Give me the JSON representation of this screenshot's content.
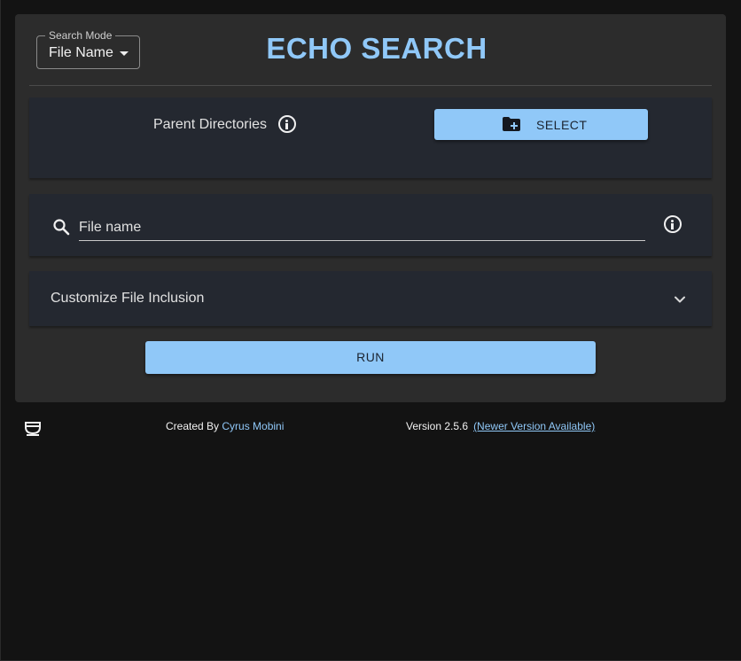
{
  "header": {
    "mode_label": "Search Mode",
    "mode_value": "File Name",
    "title": "ECHO SEARCH"
  },
  "directories": {
    "label": "Parent Directories",
    "select_button": "SELECT"
  },
  "search": {
    "placeholder": "File name",
    "value": ""
  },
  "customize": {
    "label": "Customize File Inclusion"
  },
  "run_button": "RUN",
  "footer": {
    "created_by": "Created By",
    "author": "Cyrus Mobini",
    "version": "Version 2.5.6",
    "newer_version": "(Newer Version Available)"
  },
  "icons": {
    "info": "info-icon",
    "folder_add": "folder-add-icon",
    "search": "search-icon",
    "expand": "chevron-down-icon",
    "coffee": "coffee-cup-icon"
  },
  "colors": {
    "accent": "#90c8f8",
    "card": "#2c2c2c",
    "panel": "#242830",
    "background": "#131313"
  }
}
